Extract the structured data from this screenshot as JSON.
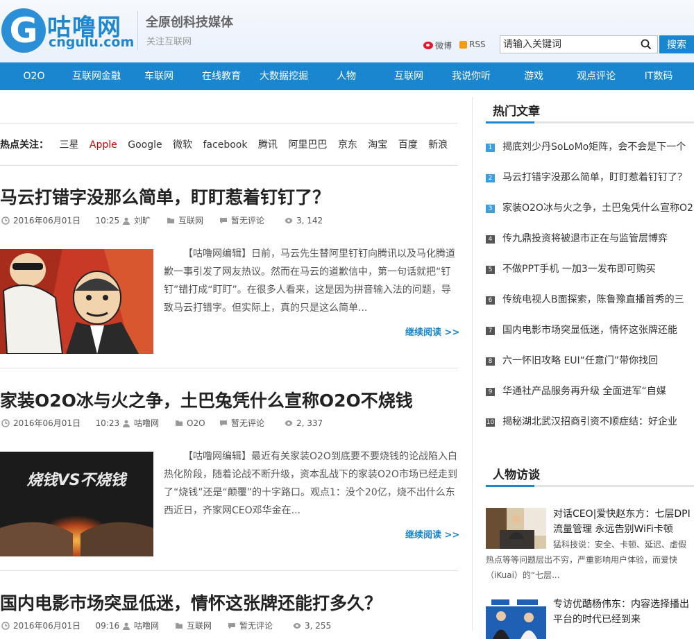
{
  "header": {
    "logo_name": "咕噜网",
    "logo_domain": "cngulu.com",
    "slogan_main": "全原创科技媒体",
    "slogan_sub": "关注互联网",
    "weibo_label": "微博",
    "rss_label": "RSS",
    "search_placeholder": "请输入关键词",
    "search_button": "搜索"
  },
  "nav": [
    "O2O",
    "互联网金融",
    "车联网",
    "在线教育",
    "大数据挖掘",
    "人物",
    "互联网",
    "我说你听",
    "游戏",
    "观点评论",
    "IT数码"
  ],
  "hot_focus": {
    "label": "热点关注：",
    "tags": [
      "三星",
      "Apple",
      "Google",
      "微软",
      "facebook",
      "腾讯",
      "阿里巴巴",
      "京东",
      "淘宝",
      "百度",
      "新浪"
    ]
  },
  "articles": [
    {
      "title": "马云打错字没那么简单，盯盯惹着钉钉了？",
      "date": "2016年06月01日",
      "time": "10:25",
      "author": "刘旷",
      "category": "互联网",
      "comments": "暂无评论",
      "views": "3, 142",
      "excerpt": "【咕噜网编辑】日前，马云先生替阿里钉钉向腾讯以及马化腾道歉一事引发了网友热议。然而在马云的道歉信中，第一句话就把“钉钉”错打成“盯盯”。在很多人看来，这是因为拼音输入法的问题，导致马云打错字。但实际上，真的只是这么简单...",
      "read_more": "继续阅读 >>"
    },
    {
      "title": "家装O2O冰与火之争，土巴兔凭什么宣称O2O不烧钱",
      "date": "2016年06月01日",
      "time": "10:23",
      "author": "咕噜网",
      "category": "O2O",
      "comments": "暂无评论",
      "views": "2, 337",
      "excerpt": "【咕噜网编辑】最近有关家装O2O到底要不要烧钱的论战陷入白热化阶段，随着论战不断升级，资本乱战下的家装O2O市场已经走到了“烧钱”还是“颠覆”的十字路口。观点1：没个20亿，烧不出什么东西近日，齐家网CEO邓华金在...",
      "image_text": "烧钱VS不烧钱",
      "read_more": "继续阅读 >>"
    },
    {
      "title": "国内电影市场突显低迷，情怀这张牌还能打多久？",
      "date": "2016年06月01日",
      "time": "09:16",
      "author": "咕噜网",
      "category": "互联网",
      "comments": "暂无评论",
      "views": "3, 255"
    }
  ],
  "sidebar": {
    "hot_title": "热门文章",
    "hot_articles": [
      "揭底刘少丹SoLoMo矩阵，会不会是下一个",
      "马云打错字没那么简单，盯盯惹着钉钉了？",
      "家装O2O冰与火之争，土巴兔凭什么宣称O2",
      "传九鼎投资将被退市正在与监管层博弈",
      "不做PPT手机 一加3一发布即可购买",
      "传统电视人B面探索，陈鲁豫直播首秀的三",
      "国内电影市场突显低迷，情怀这张牌还能",
      "六一怀旧攻略 EUI“任意门”带你找回",
      "华通社产品服务再升级 全面进军“自媒",
      "揭秘湖北武汉招商引资不顺症结：好企业"
    ],
    "interview_title": "人物访谈",
    "interviews": [
      {
        "title": "对话CEO|爱快赵东方：七层DPI流量管理 永远告别WiFi卡顿",
        "desc": "猛科技说：安全、卡顿、延迟、虚假热点等等问题层出不穷，严重影响用户体验，而爱快（iKuai）的“七层..."
      },
      {
        "title": "专访优酷杨伟东：内容选择播出平台的时代已经到来",
        "desc": ""
      }
    ]
  },
  "colors": {
    "brand_blue": "#1a86cf",
    "hot_tag_red": "#cc0000"
  }
}
